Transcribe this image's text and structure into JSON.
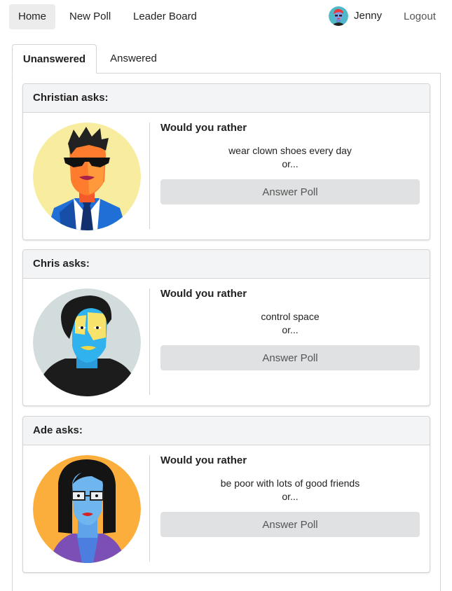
{
  "nav": {
    "items": [
      {
        "label": "Home",
        "active": true
      },
      {
        "label": "New Poll",
        "active": false
      },
      {
        "label": "Leader Board",
        "active": false
      }
    ],
    "user_name": "Jenny",
    "logout_label": "Logout"
  },
  "tabs": [
    {
      "label": "Unanswered",
      "active": true
    },
    {
      "label": "Answered",
      "active": false
    }
  ],
  "polls": [
    {
      "asker": "Christian asks:",
      "prompt": "Would you rather",
      "option": "wear clown shoes every day",
      "or": "or...",
      "button": "Answer Poll",
      "avatar": "christian-avatar-icon"
    },
    {
      "asker": "Chris asks:",
      "prompt": "Would you rather",
      "option": "control space",
      "or": "or...",
      "button": "Answer Poll",
      "avatar": "chris-avatar-icon"
    },
    {
      "asker": "Ade asks:",
      "prompt": "Would you rather",
      "option": "be poor with lots of good friends",
      "or": "or...",
      "button": "Answer Poll",
      "avatar": "ade-avatar-icon"
    }
  ],
  "colors": {
    "active_nav_bg": "#ececec",
    "card_header_bg": "#f3f4f5",
    "button_bg": "#e0e1e2",
    "border": "#d4d4d5"
  }
}
